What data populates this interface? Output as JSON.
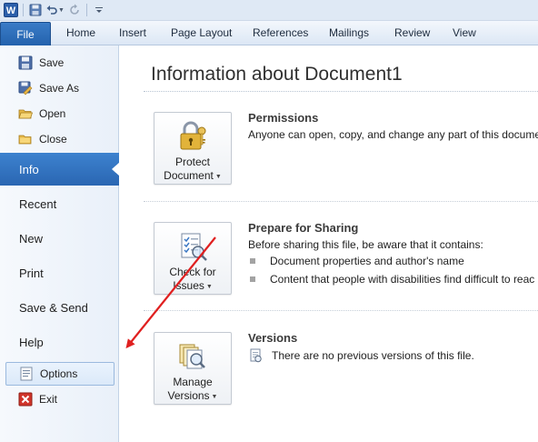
{
  "quick_access": {
    "app_icon": "word-icon",
    "buttons": [
      "save-icon",
      "undo-icon",
      "redo-icon",
      "customize-icon"
    ]
  },
  "ribbon": {
    "file_label": "File",
    "tabs": [
      "Home",
      "Insert",
      "Page Layout",
      "References",
      "Mailings",
      "Review",
      "View"
    ]
  },
  "nav": {
    "commands": [
      {
        "label": "Save",
        "icon": "save-icon"
      },
      {
        "label": "Save As",
        "icon": "save-as-icon"
      },
      {
        "label": "Open",
        "icon": "open-folder-icon"
      },
      {
        "label": "Close",
        "icon": "close-folder-icon"
      }
    ],
    "items": [
      "Info",
      "Recent",
      "New",
      "Print",
      "Save & Send",
      "Help"
    ],
    "options_label": "Options",
    "exit_label": "Exit"
  },
  "main": {
    "title": "Information about Document1",
    "permissions": {
      "button_line1": "Protect",
      "button_line2": "Document",
      "heading": "Permissions",
      "text": "Anyone can open, copy, and change any part of this docume"
    },
    "sharing": {
      "button_line1": "Check for",
      "button_line2": "Issues",
      "heading": "Prepare for Sharing",
      "text": "Before sharing this file, be aware that it contains:",
      "bullets": [
        "Document properties and author's name",
        "Content that people with disabilities find difficult to reac"
      ]
    },
    "versions": {
      "button_line1": "Manage",
      "button_line2": "Versions",
      "heading": "Versions",
      "text": "There are no previous versions of this file."
    }
  },
  "colors": {
    "accent": "#2a66b2",
    "annotation_arrow": "#e02020"
  }
}
